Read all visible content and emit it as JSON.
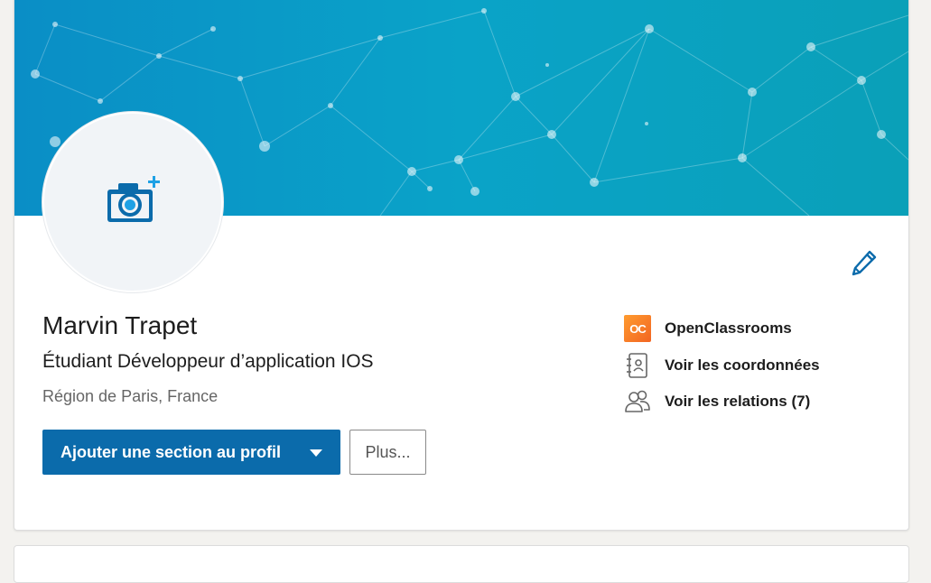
{
  "profile": {
    "name": "Marvin Trapet",
    "headline": "Étudiant Développeur d’application IOS",
    "location": "Région de Paris, France"
  },
  "actions": {
    "add_section_label": "Ajouter une section au profil",
    "more_label": "Plus..."
  },
  "side": {
    "company": {
      "name": "OpenClassrooms",
      "logo_text": "OC",
      "icon": "openclassrooms-logo"
    },
    "contact": {
      "label": "Voir les coordonnées",
      "icon": "contact-book-icon"
    },
    "relations": {
      "label": "Voir les relations (7)",
      "icon": "people-icon"
    }
  },
  "icons": {
    "avatar": "camera-plus-icon",
    "edit": "pencil-icon"
  },
  "colors": {
    "primary": "#0b6bab",
    "banner_start": "#0a8ec6",
    "banner_end": "#0aa0b8",
    "oc_orange": "#f26522"
  }
}
